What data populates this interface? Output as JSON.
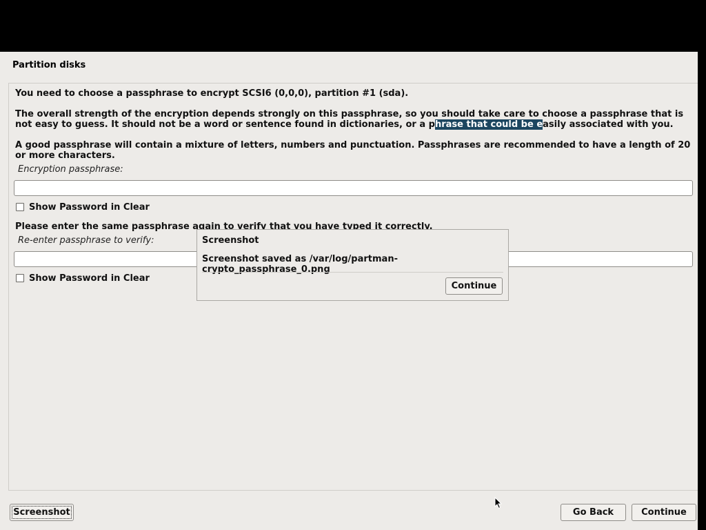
{
  "window": {
    "title": "Partition disks"
  },
  "main": {
    "intro": "You need to choose a passphrase to encrypt SCSI6 (0,0,0), partition #1 (sda).",
    "strength_before": "The overall strength of the encryption depends strongly on this passphrase, so you should take care to choose a passphrase that is not easy to guess. It should not be a word or sentence found in dictionaries, or a p",
    "strength_selected": "hrase that could be e",
    "strength_after": "asily associated with you.",
    "advice": "A good passphrase will contain a mixture of letters, numbers and punctuation. Passphrases are recommended to have a length of 20 or more characters.",
    "passphrase_label": "Encryption passphrase:",
    "passphrase_value": "",
    "show_password_label": "Show Password in Clear",
    "verify_intro": "Please enter the same passphrase again to verify that you have typed it correctly.",
    "verify_label": "Re-enter passphrase to verify:",
    "verify_value": "",
    "show_password_label_2": "Show Password in Clear"
  },
  "dialog": {
    "title": "Screenshot",
    "message": "Screenshot saved as /var/log/partman-crypto_passphrase_0.png",
    "continue_label": "Continue"
  },
  "buttons": {
    "screenshot": "Screenshot",
    "go_back": "Go Back",
    "continue": "Continue"
  },
  "colors": {
    "window_bg": "#edebe8",
    "selection_bg": "#1c4660",
    "outer_bg": "#000000"
  },
  "icons": {
    "cursor": "mouse-pointer-icon"
  }
}
